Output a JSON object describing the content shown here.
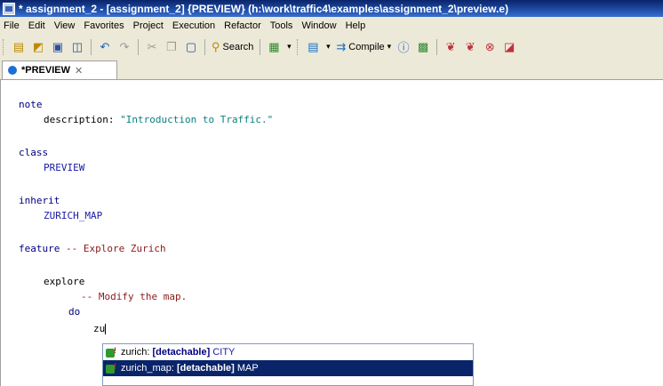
{
  "window": {
    "title": "* assignment_2 - [assignment_2] {PREVIEW} (h:\\work\\traffic4\\examples\\assignment_2\\preview.e)"
  },
  "menu": [
    "File",
    "Edit",
    "View",
    "Favorites",
    "Project",
    "Execution",
    "Refactor",
    "Tools",
    "Window",
    "Help"
  ],
  "toolbar": {
    "search_label": "Search",
    "compile_label": "Compile"
  },
  "tab": {
    "label": "*PREVIEW"
  },
  "code": {
    "l1": "note",
    "l2_key": "description:",
    "l2_val": "\"Introduction to Traffic.\"",
    "l3": "class",
    "l4": "PREVIEW",
    "l5": "inherit",
    "l6": "ZURICH_MAP",
    "l7_kw": "feature",
    "l7_cm": "-- Explore Zurich",
    "l8": "explore",
    "l9": "-- Modify the map.",
    "l10": "do",
    "l11": "zu"
  },
  "completion": [
    {
      "name": "zurich:",
      "kw": "[detachable]",
      "type": "CITY",
      "selected": false
    },
    {
      "name": "zurich_map:",
      "kw": "[detachable]",
      "type": "MAP",
      "selected": true
    }
  ],
  "colors": {
    "title_bar": "#0a246a",
    "keyword": "#00007f",
    "string": "#0a7f7f",
    "comment": "#8b1a1a",
    "selection": "#0a246a"
  }
}
